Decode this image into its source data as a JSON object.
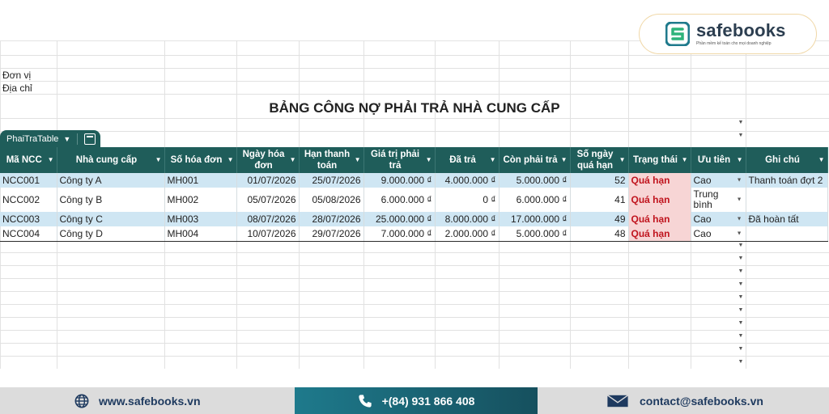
{
  "brand": {
    "name": "safebooks",
    "tagline": "Phần mềm kế toán cho mọi doanh nghiệp"
  },
  "sheet": {
    "label_donvi": "Đơn vị",
    "label_diachi": "Địa chỉ",
    "title": "BẢNG CÔNG NỢ PHẢI TRẢ NHÀ CUNG CẤP",
    "table_name": "PhaiTraTable"
  },
  "table": {
    "headers": [
      "Mã NCC",
      "Nhà cung cấp",
      "Số hóa đơn",
      "Ngày hóa đơn",
      "Hạn thanh toán",
      "Giá trị phải trả",
      "Đã trả",
      "Còn phải trả",
      "Số ngày quá hạn",
      "Trạng thái",
      "Ưu tiên",
      "Ghi chú"
    ],
    "rows": [
      [
        "NCC001",
        "Công ty A",
        "MH001",
        "01/07/2026",
        "25/07/2026",
        "9.000.000 ₫",
        "4.000.000 ₫",
        "5.000.000 ₫",
        "52",
        "Quá hạn",
        "Cao",
        "Thanh toán đợt 2"
      ],
      [
        "NCC002",
        "Công ty B",
        "MH002",
        "05/07/2026",
        "05/08/2026",
        "6.000.000 ₫",
        "0 ₫",
        "6.000.000 ₫",
        "41",
        "Quá hạn",
        "Trung bình",
        ""
      ],
      [
        "NCC003",
        "Công ty C",
        "MH003",
        "08/07/2026",
        "28/07/2026",
        "25.000.000 ₫",
        "8.000.000 ₫",
        "17.000.000 ₫",
        "49",
        "Quá hạn",
        "Cao",
        "Đã hoàn tất"
      ],
      [
        "NCC004",
        "Công ty D",
        "MH004",
        "10/07/2026",
        "29/07/2026",
        "7.000.000 ₫",
        "2.000.000 ₫",
        "5.000.000 ₫",
        "48",
        "Quá hạn",
        "Cao",
        ""
      ]
    ]
  },
  "footer": {
    "website": "www.safebooks.vn",
    "phone": "+(84) 931 866 408",
    "email": "contact@safebooks.vn"
  },
  "colors": {
    "header_bg": "#1f5d5a",
    "row_alt": "#cfe6f3",
    "status_bg": "#f7d5d5",
    "status_text": "#c0141e"
  }
}
